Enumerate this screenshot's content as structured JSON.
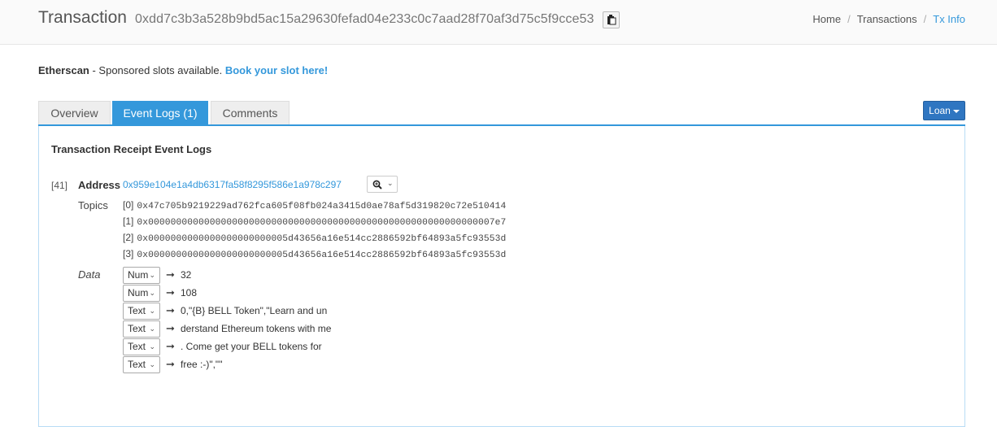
{
  "header": {
    "title": "Transaction",
    "tx_hash": "0xdd7c3b3a528b9bd5ac15a29630fefad04e233c0c7aad28f70af3d75c5f9cce53",
    "copy_icon": "clipboard-icon",
    "breadcrumb": [
      {
        "label": "Home"
      },
      {
        "label": "Transactions"
      },
      {
        "label": "Tx Info"
      }
    ],
    "breadcrumb_sep": "/"
  },
  "sponsor": {
    "brand": "Etherscan",
    "text": " - Sponsored slots available. ",
    "link": "Book your slot here!"
  },
  "tabs": [
    {
      "label": "Overview",
      "active": false
    },
    {
      "label": "Event Logs (1)",
      "active": true
    },
    {
      "label": "Comments",
      "active": false
    }
  ],
  "loan_button": {
    "label": "Loan"
  },
  "event_logs": {
    "title": "Transaction Receipt Event Logs",
    "log": {
      "index": "[41]",
      "address_label": "Address",
      "address": "0x959e104e1a4db6317fa58f8295f586e1a978c297",
      "zoom_icon": "magnifier-icon",
      "topics_label": "Topics",
      "topics": [
        {
          "idx": "[0]",
          "value": "0x47c705b9219229ad762fca605f08fb024a3415d0ae78af5d319820c72e510414"
        },
        {
          "idx": "[1]",
          "value": "0x00000000000000000000000000000000000000000000000000000000000007e7"
        },
        {
          "idx": "[2]",
          "value": "0x0000000000000000000000005d43656a16e514cc2886592bf64893a5fc93553d"
        },
        {
          "idx": "[3]",
          "value": "0x0000000000000000000000005d43656a16e514cc2886592bf64893a5fc93553d"
        }
      ],
      "data_label": "Data",
      "data_arrow": "➞",
      "data": [
        {
          "format": "Num",
          "value": "32"
        },
        {
          "format": "Num",
          "value": "108"
        },
        {
          "format": "Text",
          "value": "0,\"{B} BELL Token\",\"Learn and un"
        },
        {
          "format": "Text",
          "value": "derstand Ethereum tokens with me"
        },
        {
          "format": "Text",
          "value": ". Come get your BELL tokens for"
        },
        {
          "format": "Text",
          "value": "free :-)\",\"\""
        }
      ]
    }
  },
  "colors": {
    "accent": "#3498db",
    "loan_button": "#2f76c1",
    "panel_border": "#b8dcf5"
  }
}
